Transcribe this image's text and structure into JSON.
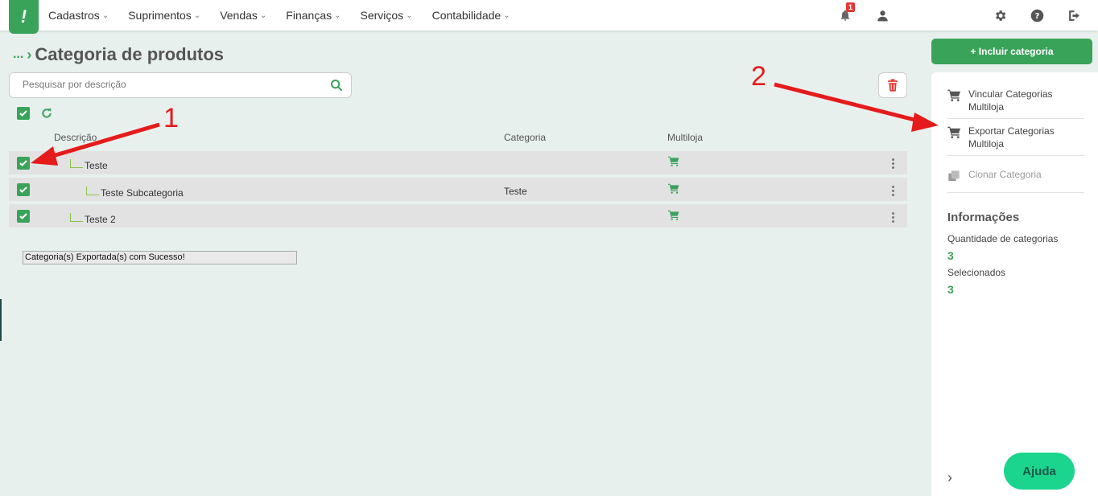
{
  "nav": {
    "logo": "!",
    "items": [
      {
        "label": "Cadastros"
      },
      {
        "label": "Suprimentos"
      },
      {
        "label": "Vendas"
      },
      {
        "label": "Finanças"
      },
      {
        "label": "Serviços"
      },
      {
        "label": "Contabilidade"
      }
    ],
    "notification_count": "1",
    "icons": [
      "bell-icon",
      "user-icon",
      "gear-icon",
      "help-icon",
      "logout-icon"
    ]
  },
  "breadcrumb": {
    "ellipsis": "...",
    "separator": "›"
  },
  "page": {
    "title": "Categoria de produtos"
  },
  "search": {
    "placeholder": "Pesquisar por descrição",
    "value": ""
  },
  "table": {
    "headers": {
      "description": "Descrição",
      "category": "Categoria",
      "multistore": "Multiloja"
    },
    "rows": [
      {
        "description": "Teste",
        "category": "",
        "checked": true,
        "level": 1
      },
      {
        "description": "Teste Subcategoria",
        "category": "Teste",
        "checked": true,
        "level": 2
      },
      {
        "description": "Teste 2",
        "category": "",
        "checked": true,
        "level": 1
      }
    ]
  },
  "toast": {
    "message": "Categoria(s) Exportada(s) com Sucesso!"
  },
  "sidebar": {
    "add_label": "+ Incluir categoria",
    "actions": [
      {
        "line1": "Vincular Categorias",
        "line2": "Multiloja"
      },
      {
        "line1": "Exportar Categorias",
        "line2": "Multiloja"
      },
      {
        "line1": "Clonar Categoria",
        "line2": ""
      }
    ],
    "info_title": "Informações",
    "qty_label": "Quantidade de categorias",
    "qty_value": "3",
    "selected_label": "Selecionados",
    "selected_value": "3",
    "help_label": "Ajuda"
  },
  "annotations": {
    "one": "1",
    "two": "2"
  },
  "colors": {
    "brand": "#3aa35a",
    "help": "#1bd58f",
    "annotation": "#e51b1b",
    "danger": "#e53935"
  }
}
